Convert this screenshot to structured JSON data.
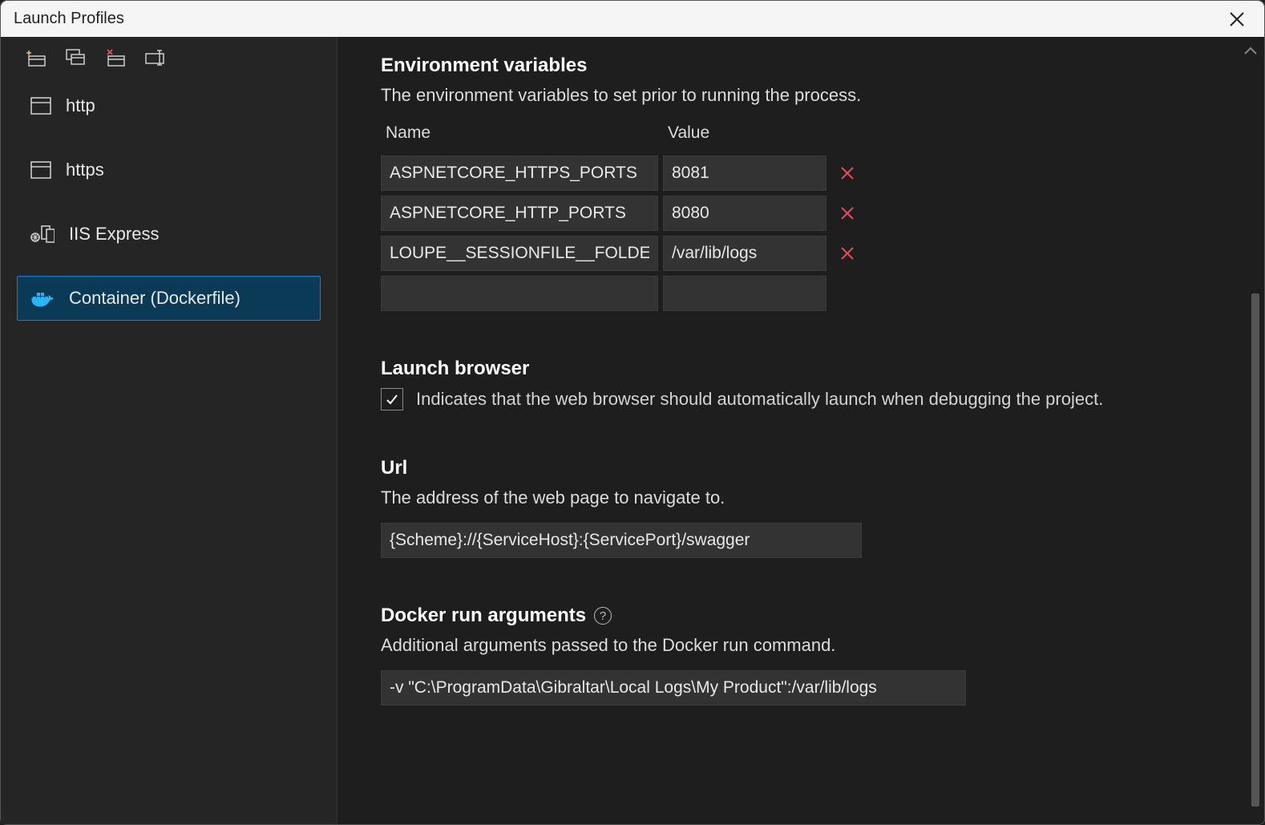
{
  "window": {
    "title": "Launch Profiles"
  },
  "sidebar": {
    "profiles": [
      {
        "label": "http"
      },
      {
        "label": "https"
      },
      {
        "label": "IIS Express"
      },
      {
        "label": "Container (Dockerfile)"
      }
    ]
  },
  "env": {
    "title": "Environment variables",
    "desc": "The environment variables to set prior to running the process.",
    "headers": {
      "name": "Name",
      "value": "Value"
    },
    "rows": [
      {
        "name": "ASPNETCORE_HTTPS_PORTS",
        "value": "8081"
      },
      {
        "name": "ASPNETCORE_HTTP_PORTS",
        "value": "8080"
      },
      {
        "name": "LOUPE__SESSIONFILE__FOLDER",
        "value": "/var/lib/logs"
      }
    ]
  },
  "launchBrowser": {
    "title": "Launch browser",
    "desc": "Indicates that the web browser should automatically launch when debugging the project.",
    "checked": true
  },
  "url": {
    "title": "Url",
    "desc": "The address of the web page to navigate to.",
    "value": "{Scheme}://{ServiceHost}:{ServicePort}/swagger"
  },
  "dockerArgs": {
    "title": "Docker run arguments",
    "desc": "Additional arguments passed to the Docker run command.",
    "value": "-v \"C:\\ProgramData\\Gibraltar\\Local Logs\\My Product\":/var/lib/logs"
  }
}
